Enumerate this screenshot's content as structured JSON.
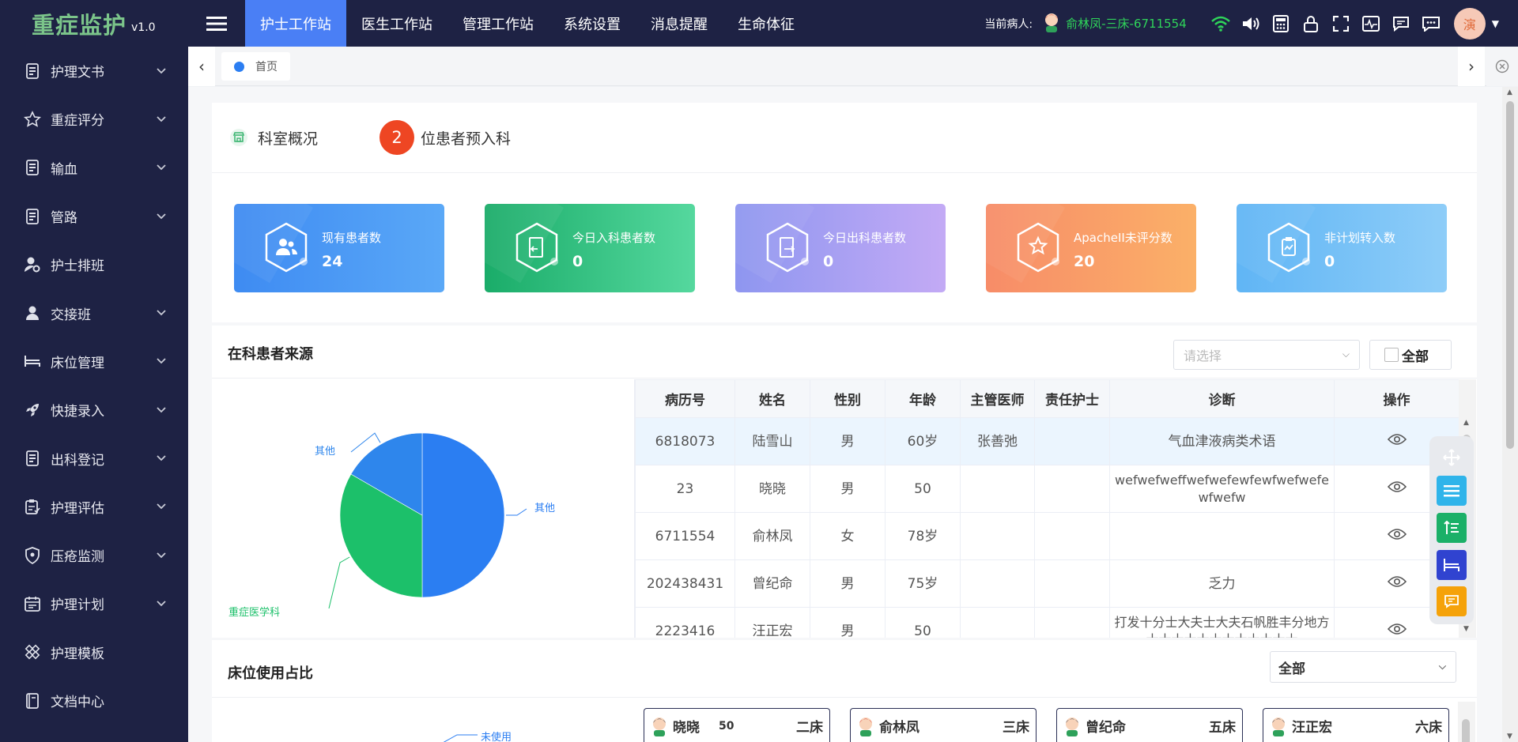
{
  "app": {
    "name": "重症监护",
    "version": "v1.0"
  },
  "topnav": [
    "护士工作站",
    "医生工作站",
    "管理工作站",
    "系统设置",
    "消息提醒",
    "生命体征"
  ],
  "header": {
    "current_patient_label": "当前病人:",
    "current_patient": "俞林凤-三床-6711554",
    "avatar_text": "演"
  },
  "sidebar": [
    {
      "label": "护理文书",
      "icon": "document-icon",
      "has_children": true
    },
    {
      "label": "重症评分",
      "icon": "star-outline-icon",
      "has_children": true
    },
    {
      "label": "输血",
      "icon": "document-icon",
      "has_children": true
    },
    {
      "label": "管路",
      "icon": "document-icon",
      "has_children": true
    },
    {
      "label": "护士排班",
      "icon": "user-gear-icon",
      "has_children": false
    },
    {
      "label": "交接班",
      "icon": "user-icon",
      "has_children": true
    },
    {
      "label": "床位管理",
      "icon": "bed-icon",
      "has_children": true
    },
    {
      "label": "快捷录入",
      "icon": "rocket-icon",
      "has_children": true
    },
    {
      "label": "出科登记",
      "icon": "document-icon",
      "has_children": true
    },
    {
      "label": "护理评估",
      "icon": "clipboard-icon",
      "has_children": true
    },
    {
      "label": "压疮监测",
      "icon": "shield-icon",
      "has_children": true
    },
    {
      "label": "护理计划",
      "icon": "calendar-icon",
      "has_children": true
    },
    {
      "label": "护理模板",
      "icon": "template-icon",
      "has_children": false
    },
    {
      "label": "文档中心",
      "icon": "book-icon",
      "has_children": false
    }
  ],
  "tabs": [
    {
      "label": "首页"
    }
  ],
  "overview": {
    "title": "科室概况",
    "preadmit_count": "2",
    "preadmit_label": "位患者预入科"
  },
  "stat_cards": [
    {
      "label": "现有患者数",
      "value": "24",
      "from": "#3e8bf2",
      "to": "#5aa8f7",
      "icon": "users-icon"
    },
    {
      "label": "今日入科患者数",
      "value": "0",
      "from": "#1aac69",
      "to": "#55d89e",
      "icon": "door-in-icon"
    },
    {
      "label": "今日出科患者数",
      "value": "0",
      "from": "#8e96f0",
      "to": "#c3aaf5",
      "icon": "door-out-icon"
    },
    {
      "label": "ApacheII未评分数",
      "value": "20",
      "from": "#f78c68",
      "to": "#fbb068",
      "icon": "star-icon"
    },
    {
      "label": "非计划转入数",
      "value": "0",
      "from": "#60b5f5",
      "to": "#8ecdf8",
      "icon": "clipboard-icon"
    }
  ],
  "source": {
    "title": "在科患者来源",
    "select_placeholder": "请选择",
    "all_label": "全部",
    "columns": [
      "病历号",
      "姓名",
      "性别",
      "年龄",
      "主管医师",
      "责任护士",
      "诊断",
      "操作"
    ],
    "rows": [
      {
        "id": "6818073",
        "name": "陆雪山",
        "sex": "男",
        "age": "60岁",
        "doctor": "张善弛",
        "nurse": "",
        "diag": "气血津液病类术语"
      },
      {
        "id": "23",
        "name": "晓晓",
        "sex": "男",
        "age": "50",
        "doctor": "",
        "nurse": "",
        "diag": "wefwefweffwefwefewfewfwefwefewfwefw"
      },
      {
        "id": "6711554",
        "name": "俞林凤",
        "sex": "女",
        "age": "78岁",
        "doctor": "",
        "nurse": "",
        "diag": ""
      },
      {
        "id": "202438431",
        "name": "曾纪命",
        "sex": "男",
        "age": "75岁",
        "doctor": "",
        "nurse": "",
        "diag": "乏力"
      },
      {
        "id": "2223416",
        "name": "汪正宏",
        "sex": "男",
        "age": "50",
        "doctor": "",
        "nurse": "",
        "diag": "打发十分士大夫士大夫石帆胜丰分地方士士士士士士士士士士士士"
      }
    ]
  },
  "chart_data": {
    "type": "pie",
    "slices": [
      {
        "name": "其他",
        "value": 12,
        "color": "#2b7ef2"
      },
      {
        "name": "重症医学科",
        "value": 8,
        "color": "#1cc06a"
      },
      {
        "name": "其他",
        "value": 4,
        "color": "#2e86ec"
      }
    ]
  },
  "bed_usage": {
    "title": "床位使用占比",
    "select_value": "全部",
    "unused_label": "未使用",
    "beds": [
      {
        "name": "晓晓",
        "age": "50",
        "bed": "二床",
        "sex": "male"
      },
      {
        "name": "俞林凤",
        "age": "",
        "bed": "三床",
        "sex": "female"
      },
      {
        "name": "曾纪命",
        "age": "",
        "bed": "五床",
        "sex": "male"
      },
      {
        "name": "汪正宏",
        "age": "",
        "bed": "六床",
        "sex": "male"
      }
    ]
  }
}
